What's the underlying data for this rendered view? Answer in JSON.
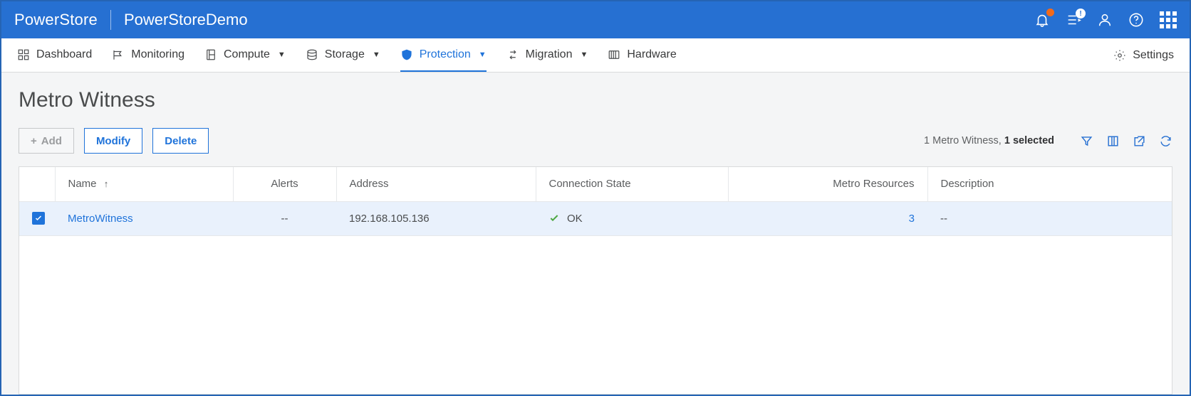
{
  "banner": {
    "product": "PowerStore",
    "cluster": "PowerStoreDemo"
  },
  "nav": {
    "dashboard": "Dashboard",
    "monitoring": "Monitoring",
    "compute": "Compute",
    "storage": "Storage",
    "protection": "Protection",
    "migration": "Migration",
    "hardware": "Hardware",
    "settings": "Settings"
  },
  "page": {
    "title": "Metro Witness",
    "add_label": "Add",
    "modify_label": "Modify",
    "delete_label": "Delete",
    "status_count": "1 Metro Witness, ",
    "status_selected": "1 selected"
  },
  "table": {
    "headers": {
      "name": "Name",
      "alerts": "Alerts",
      "address": "Address",
      "connection_state": "Connection State",
      "metro_resources": "Metro Resources",
      "description": "Description"
    },
    "rows": [
      {
        "checked": true,
        "name": "MetroWitness",
        "alerts": "--",
        "address": "192.168.105.136",
        "connection_state": "OK",
        "metro_resources": "3",
        "description": "--"
      }
    ]
  }
}
